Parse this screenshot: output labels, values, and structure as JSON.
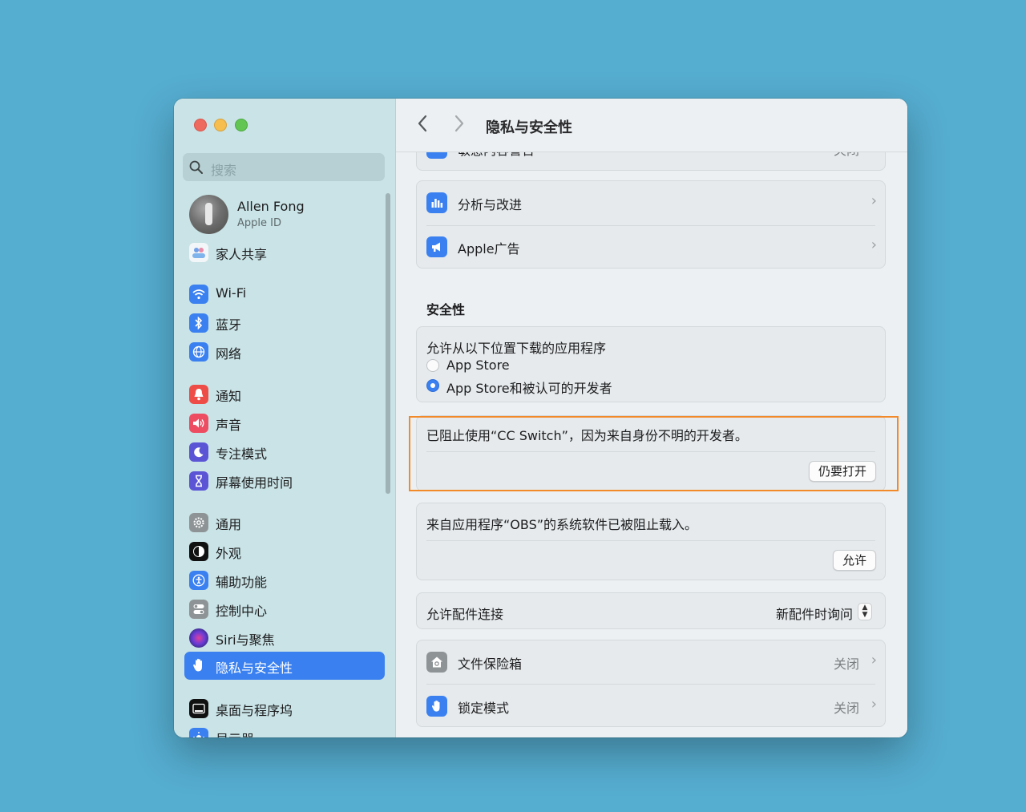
{
  "window_title": "隐私与安全性",
  "sidebar": {
    "search_placeholder": "搜索",
    "profile": {
      "name": "Allen Fong",
      "subtitle": "Apple ID"
    },
    "items": [
      {
        "label": "家人共享"
      },
      {
        "label": "Wi-Fi"
      },
      {
        "label": "蓝牙"
      },
      {
        "label": "网络"
      },
      {
        "label": "通知"
      },
      {
        "label": "声音"
      },
      {
        "label": "专注模式"
      },
      {
        "label": "屏幕使用时间"
      },
      {
        "label": "通用"
      },
      {
        "label": "外观"
      },
      {
        "label": "辅助功能"
      },
      {
        "label": "控制中心"
      },
      {
        "label": "Siri与聚焦"
      },
      {
        "label": "隐私与安全性"
      },
      {
        "label": "桌面与程序坞"
      },
      {
        "label": "显示器"
      }
    ]
  },
  "main": {
    "partial_row": {
      "label": "敏感内容警告",
      "value": "关闭"
    },
    "privacy_rows": [
      {
        "label": "分析与改进"
      },
      {
        "label": "Apple广告"
      }
    ],
    "security_heading": "安全性",
    "allow_downloads": {
      "title": "允许从以下位置下载的应用程序",
      "options": [
        "App Store",
        "App Store和被认可的开发者"
      ],
      "selected": "App Store和被认可的开发者"
    },
    "blocked_app": {
      "message": "已阻止使用“CC Switch”，因为来自身份不明的开发者。",
      "button": "仍要打开"
    },
    "blocked_extension": {
      "message": "来自应用程序“OBS”的系统软件已被阻止载入。",
      "button": "允许"
    },
    "accessories": {
      "label": "允许配件连接",
      "value": "新配件时询问"
    },
    "filevault": {
      "label": "文件保险箱",
      "value": "关闭"
    },
    "lockdown": {
      "label": "锁定模式",
      "value": "关闭"
    }
  },
  "colors": {
    "accent": "#3a80f0",
    "highlight": "#f28a2a"
  }
}
